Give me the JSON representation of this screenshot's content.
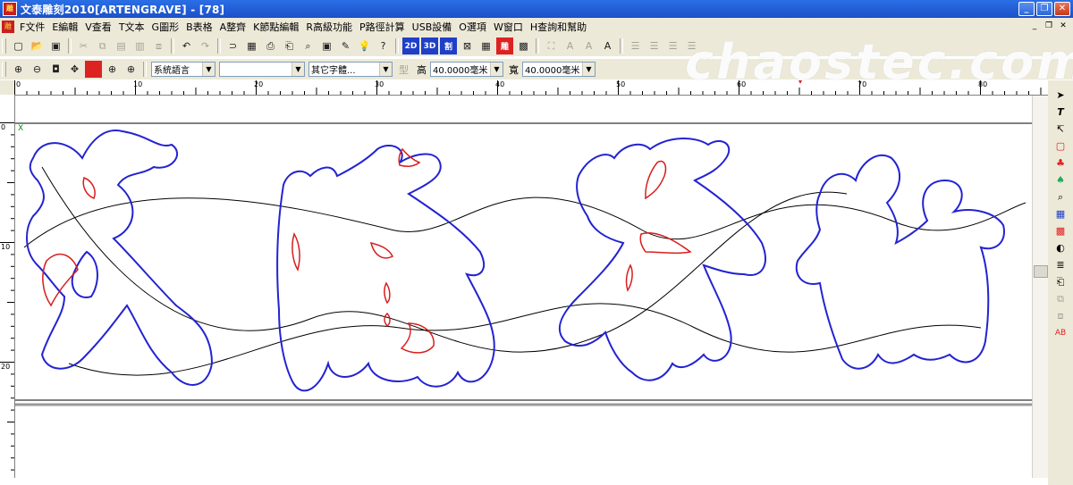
{
  "window": {
    "title": "文泰雕刻2010[ARTENGRAVE] - [78]",
    "app_icon": "雕",
    "buttons": [
      "_",
      "❐",
      "✕"
    ]
  },
  "menu": {
    "items": [
      "F文件",
      "E編輯",
      "V查看",
      "T文本",
      "G圖形",
      "B表格",
      "A整齊",
      "K節點編輯",
      "R高級功能",
      "P路徑計算",
      "USB設備",
      "O選項",
      "W窗口",
      "H查詢和幫助"
    ],
    "mdi_buttons": [
      "_",
      "❐",
      "✕"
    ]
  },
  "toolbar1": {
    "icons": [
      "new-file-icon",
      "open-file-icon",
      "save-icon",
      "cut-icon",
      "copy-icon",
      "paste-icon",
      "paste-special-icon",
      "duplicate-icon",
      "undo-icon",
      "redo-icon",
      "path-icon",
      "preview-icon",
      "print-icon",
      "print-setup-icon",
      "print-preview-icon",
      "frame-icon",
      "eyedropper-icon",
      "light-icon",
      "help-icon"
    ],
    "mode_labels": [
      "2D",
      "3D",
      "割",
      "雕"
    ],
    "align_labels": [
      "A",
      "A",
      "A"
    ]
  },
  "toolbar2": {
    "language": "系統語言",
    "font_select": "",
    "font_family": "其它字體...",
    "font_type_label": "型",
    "height_label": "高",
    "height_value": "40.0000毫米",
    "width_label": "寬",
    "width_value": "40.0000毫米"
  },
  "watermark": "chaostec.com",
  "ruler": {
    "h_labels": [
      "0",
      "10",
      "20",
      "30",
      "40",
      "50",
      "60",
      "70",
      "80"
    ],
    "v_labels": [
      "0",
      "10",
      "20"
    ]
  },
  "canvas": {
    "text": "茂騰茶行",
    "origin_label": "X",
    "outline_color": "#2323d2",
    "inner_color": "#d81e1e",
    "path_color": "#000000"
  }
}
